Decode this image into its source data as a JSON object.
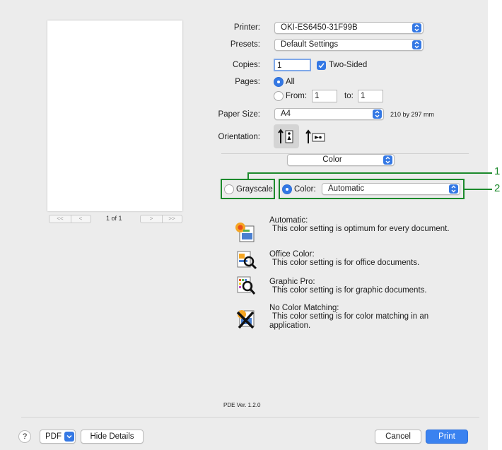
{
  "printer": {
    "label": "Printer:",
    "value": "OKI-ES6450-31F99B"
  },
  "presets": {
    "label": "Presets:",
    "value": "Default Settings"
  },
  "copies": {
    "label": "Copies:",
    "value": "1",
    "two_sided_label": "Two-Sided",
    "two_sided_checked": true
  },
  "pages": {
    "label": "Pages:",
    "all_label": "All",
    "from_label": "From:",
    "from_value": "1",
    "to_label": "to:",
    "to_value": "1"
  },
  "paper_size": {
    "label": "Paper Size:",
    "value": "A4",
    "dimensions": "210 by 297 mm"
  },
  "orientation": {
    "label": "Orientation:"
  },
  "section": {
    "value": "Color"
  },
  "color_mode": {
    "grayscale_label": "Grayscale",
    "color_label": "Color:",
    "color_value": "Automatic"
  },
  "callouts": [
    "1",
    "2"
  ],
  "color_options": [
    {
      "title": "Automatic:",
      "desc": "This color setting is optimum for every document.",
      "icon": "automatic-color-icon"
    },
    {
      "title": "Office Color:",
      "desc": "This color setting is for office documents.",
      "icon": "office-color-icon"
    },
    {
      "title": "Graphic Pro:",
      "desc": "This color setting is for graphic documents.",
      "icon": "graphic-pro-icon"
    },
    {
      "title": "No Color Matching:",
      "desc": "This color setting is for color matching in an",
      "desc2": "application.",
      "icon": "no-color-matching-icon"
    }
  ],
  "preview": {
    "page_indicator": "1 of 1"
  },
  "pde_version": "PDE Ver.  1.2.0",
  "footer": {
    "help": "?",
    "pdf": "PDF",
    "hide_details": "Hide Details",
    "cancel": "Cancel",
    "print": "Print"
  },
  "colors": {
    "accent": "#3478e4",
    "callout": "#1c8a2c",
    "panel": "#ececec"
  }
}
